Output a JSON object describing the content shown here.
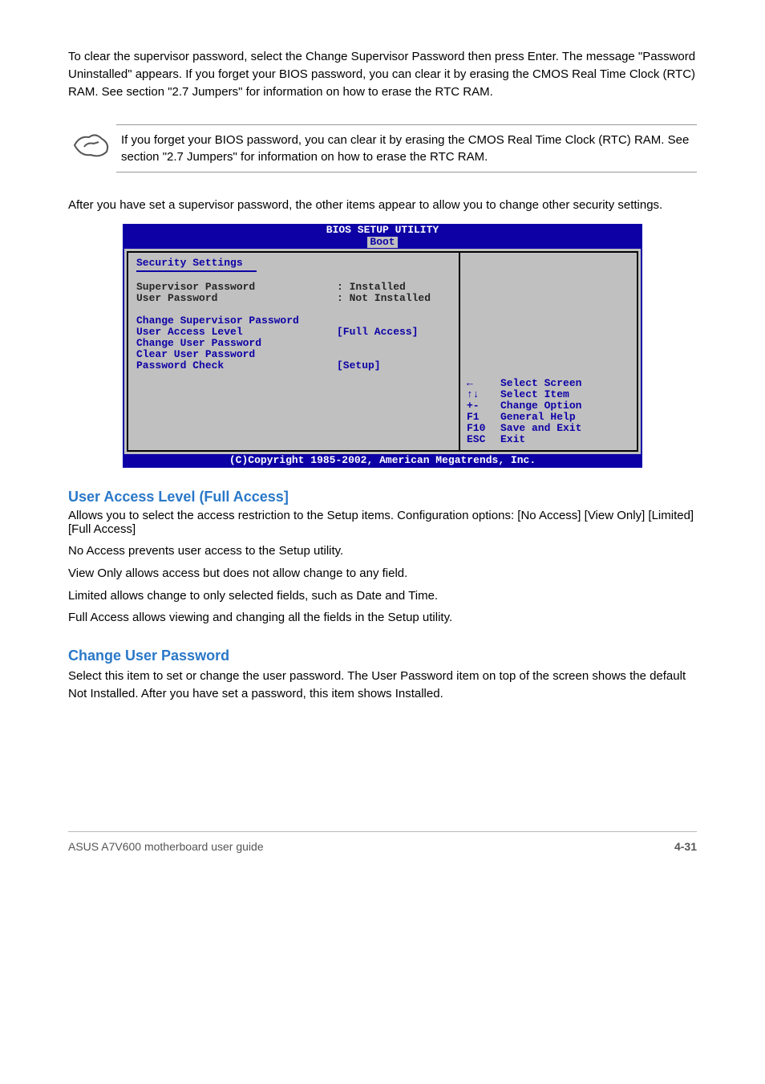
{
  "intro": {
    "p1": "To clear the supervisor password, select the Change Supervisor Password then press Enter. The message \"Password Uninstalled\" appears. If you forget your BIOS password, you can clear it by erasing the CMOS Real Time Clock (RTC) RAM. See section \"2.7 Jumpers\" for information on how to erase the RTC RAM."
  },
  "note": {
    "text": "If you forget your BIOS password, you can clear it by erasing the CMOS Real Time Clock (RTC) RAM. See section \"2.7 Jumpers\" for information on how to erase the RTC RAM."
  },
  "after_note": "After you have set a supervisor password, the other items appear to allow you to change other security settings.",
  "bios": {
    "title": "BIOS SETUP UTILITY",
    "tab": "Boot",
    "heading": "Security Settings",
    "rows": {
      "supPwdLabel": "Supervisor Password",
      "supPwdVal": ": Installed",
      "userPwdLabel": "User Password",
      "userPwdVal": ": Not Installed",
      "chgSup": "Change Supervisor Password",
      "ualLabel": "User Access Level",
      "ualVal": "[Full Access]",
      "chgUser": "Change User Password",
      "clrUser": "Clear User Password",
      "pcLabel": "Password Check",
      "pcVal": "[Setup]"
    },
    "help": {
      "r1": {
        "icon": "←",
        "text": "Select Screen"
      },
      "r2": {
        "icon": "↑↓",
        "text": "Select Item"
      },
      "r3": {
        "icon": "+-",
        "text": "Change Option"
      },
      "r4": {
        "icon": "F1",
        "text": "General Help"
      },
      "r5": {
        "icon": "F10",
        "text": "Save and Exit"
      },
      "r6": {
        "icon": "ESC",
        "text": "Exit"
      }
    },
    "footer": "(C)Copyright 1985-2002, American Megatrends, Inc."
  },
  "sections": {
    "ual": {
      "title": "User Access Level (Full Access]",
      "desc": "Allows you to select the access restriction to the Setup items. Configuration options: [No Access] [View Only] [Limited] [Full Access]",
      "opts": {
        "noAccess": "No Access prevents user access to the Setup utility.",
        "viewOnly": "View Only allows access but does not allow change to any field.",
        "limited": "Limited allows change to only selected fields, such as Date and Time.",
        "fullAccess": "Full Access allows viewing and changing all the fields in the Setup utility."
      }
    },
    "cup": {
      "title": "Change User Password",
      "desc": "Select this item to set or change the user password. The User Password item on top of the screen shows the default Not Installed. After you have set a password, this item shows Installed."
    }
  },
  "footer": {
    "left": "ASUS A7V600 motherboard user guide",
    "right": "4-31"
  }
}
